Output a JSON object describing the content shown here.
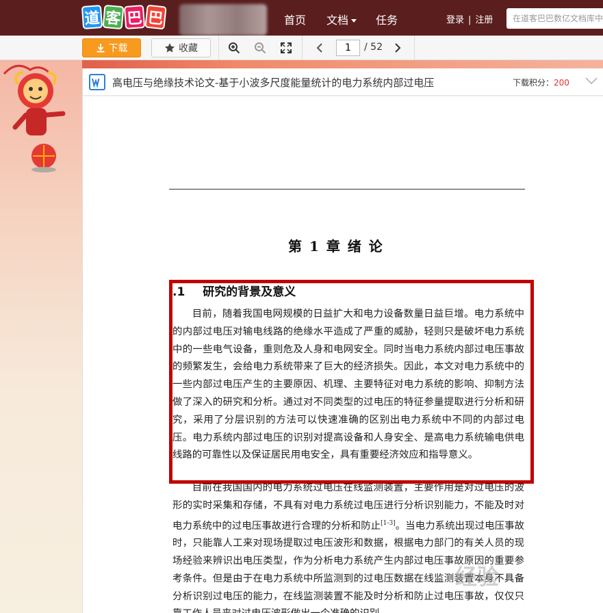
{
  "nav": {
    "logo_chars": [
      "道",
      "客",
      "巴",
      "巴"
    ],
    "logo_colors": [
      "#2196f3",
      "#4caf50",
      "#e91e63",
      "#f44336"
    ],
    "home": "首页",
    "docs": "文档",
    "task": "任务",
    "login": "登录",
    "divider": "|",
    "register": "注册",
    "search_placeholder": "在道客巴巴数亿文档库中"
  },
  "toolbar": {
    "download": "下载",
    "collect": "收藏",
    "page_current": "1",
    "page_total": "/ 52"
  },
  "doc": {
    "title": "高电压与绝缘技术论文-基于小波多尺度能量统计的电力系统内部过电压",
    "points_label": "下载积分：",
    "points_value": "200",
    "chapter": "第 1 章  绪    论",
    "section_num": ".1",
    "section_title": "研究的背景及意义",
    "p1": "目前，随着我国电网规模的日益扩大和电力设备数量日益巨增。电力系统中的内部过电压对输电线路的绝缘水平造成了严重的威胁，轻则只是破坏电力系统中的一些电气设备，重则危及人身和电网安全。同时当电力系统内部过电压事故的频繁发生，会给电力系统带来了巨大的经济损失。因此，本文对电力系统中的一些内部过电压产生的主要原因、机理、主要特征对电力系统的影响、抑制方法做了深入的研究和分析。通过对不同类型的过电压的特征参量提取进行分析和研究，采用了分层识别的方法可以快速准确的区别出电力系统中不同的内部过电压。电力系统内部过电压的识别对提高设备和人身安全、是高电力系统输电供电线路的可靠性以及保证居民用电安全，具有重要经济效应和指导意义。",
    "p2a": "目前在我国国内的电力系统过电压在线监测装置，主要作用是对过电压的波形的实时采集和存储，不具有对电力系统过电压进行分析识别能力，不能及时对电力系统中的过电压事故进行合理的分析和防止",
    "p2_ref": "[1-3]",
    "p2b": "。当电力系统出现过电压事故时，只能靠人工来对现场提取过电压波形和数据，根据电力部门的有关人员的现场经验来辨识出电压类型，作为分析电力系统产生内部过电压事故原因的重要参考条件。但是由于在电力系统中所监测到的过电压数据在线监测装置本身不具备分析识别过电压的能力，在线监测装置不能及时分析和防止过电压事故，仅仅只靠工作人员来对过电压波形做出一个准确的识别，"
  },
  "watermark": "经验"
}
